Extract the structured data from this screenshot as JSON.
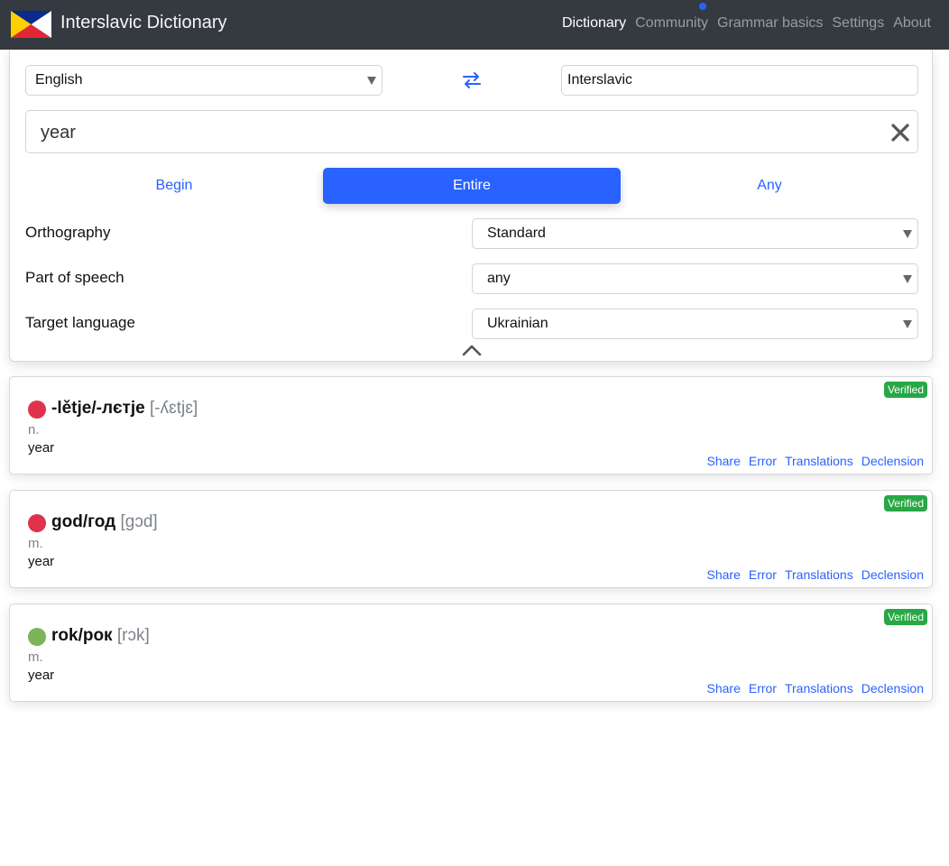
{
  "header": {
    "title": "Interslavic Dictionary",
    "nav": [
      {
        "label": "Dictionary",
        "active": true
      },
      {
        "label": "Community",
        "active": false,
        "notification": true
      },
      {
        "label": "Grammar basics",
        "active": false
      },
      {
        "label": "Settings",
        "active": false
      },
      {
        "label": "About",
        "active": false
      }
    ],
    "flag_colors": {
      "top": "#0a2a8c",
      "left": "#ffd000",
      "bottom": "#e32636",
      "right": "#ffffff"
    }
  },
  "search": {
    "from_language": "English",
    "to_language": "Interslavic",
    "query": "year",
    "modes": [
      "Begin",
      "Entire",
      "Any"
    ],
    "selected_mode": "Entire",
    "options": [
      {
        "label": "Orthography",
        "value": "Standard"
      },
      {
        "label": "Part of speech",
        "value": "any"
      },
      {
        "label": "Target language",
        "value": "Ukrainian"
      }
    ]
  },
  "results": [
    {
      "word": "-lětje/-лєтje",
      "ipa": "[-ʎɛtjɛ]",
      "pos": "n.",
      "meaning": "year",
      "badge": "Verified",
      "dot_color": "#e0324b",
      "actions": [
        "Share",
        "Error",
        "Translations",
        "Declension"
      ]
    },
    {
      "word": "god/год",
      "ipa": "[gɔd]",
      "pos": "m.",
      "meaning": "year",
      "badge": "Verified",
      "dot_color": "#e0324b",
      "actions": [
        "Share",
        "Error",
        "Translations",
        "Declension"
      ]
    },
    {
      "word": "rok/рок",
      "ipa": "[rɔk]",
      "pos": "m.",
      "meaning": "year",
      "badge": "Verified",
      "dot_color": "#7cb45a",
      "actions": [
        "Share",
        "Error",
        "Translations",
        "Declension"
      ]
    }
  ],
  "colors": {
    "accent": "#2962ff",
    "header_bg": "#343a40",
    "verified": "#28a745"
  }
}
